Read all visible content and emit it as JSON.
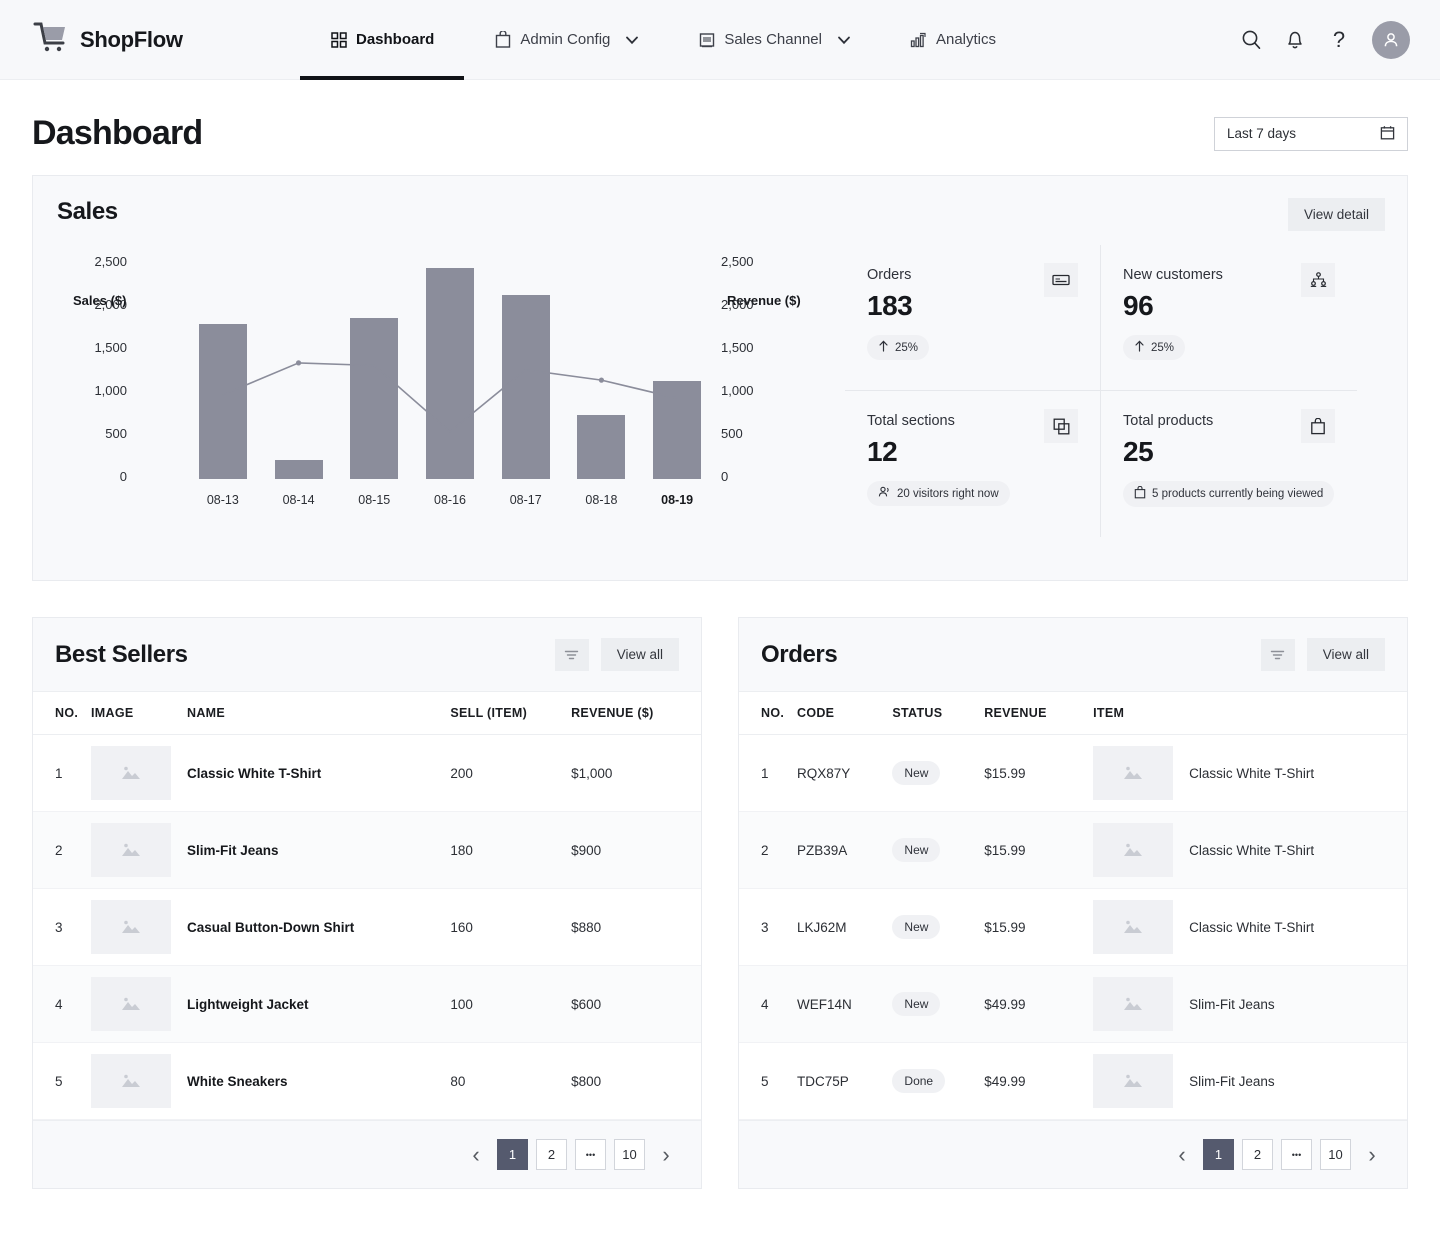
{
  "brand": {
    "name": "ShopFlow",
    "logo_icon": "shopping-cart-icon"
  },
  "nav": {
    "items": [
      {
        "label": "Dashboard",
        "icon": "grid-icon",
        "active": true,
        "caret": false
      },
      {
        "label": "Admin Config",
        "icon": "bag-icon",
        "active": false,
        "caret": true
      },
      {
        "label": "Sales Channel",
        "icon": "store-icon",
        "active": false,
        "caret": true
      },
      {
        "label": "Analytics",
        "icon": "bar-chart-icon",
        "active": false,
        "caret": false
      }
    ],
    "actions": [
      {
        "name": "search-icon"
      },
      {
        "name": "notification-bell-icon"
      },
      {
        "name": "help-icon",
        "glyph": "?"
      },
      {
        "name": "avatar"
      }
    ]
  },
  "page": {
    "title": "Dashboard",
    "date_range": "Last 7 days",
    "calendar_icon": "calendar-icon"
  },
  "sales": {
    "title": "Sales",
    "view_detail_label": "View detail"
  },
  "chart_data": {
    "type": "bar",
    "title": "Sales",
    "categories": [
      "08-13",
      "08-14",
      "08-15",
      "08-16",
      "08-17",
      "08-18",
      "08-19"
    ],
    "highlighted_category": "08-19",
    "left_axis": {
      "label": "Sales ($)",
      "ticks": [
        "2,500",
        "2,000",
        "1,500",
        "1,000",
        "500",
        "0"
      ],
      "ylim": [
        0,
        2500
      ]
    },
    "right_axis": {
      "label": "Revenue ($)",
      "ticks": [
        "2,500",
        "2,000",
        "1,500",
        "1,000",
        "500",
        "0"
      ],
      "ylim": [
        0,
        2500
      ]
    },
    "series": [
      {
        "name": "Sales ($)",
        "type": "bar",
        "color": "#8b8d9b",
        "values": [
          1800,
          220,
          1870,
          2450,
          2140,
          745,
          1140
        ]
      },
      {
        "name": "Revenue ($)",
        "type": "line",
        "color": "#8b8d9b",
        "values": [
          980,
          1350,
          1320,
          550,
          1270,
          1150,
          940
        ],
        "markers": [
          false,
          true,
          false,
          false,
          false,
          true,
          false
        ]
      }
    ],
    "grid": false,
    "legend": "none"
  },
  "stats": [
    {
      "label": "Orders",
      "value": "183",
      "icon": "card-swipe-icon",
      "pill": {
        "icon": "arrow-up-icon",
        "text": "25%"
      }
    },
    {
      "label": "New customers",
      "value": "96",
      "icon": "people-network-icon",
      "pill": {
        "icon": "arrow-up-icon",
        "text": "25%"
      }
    },
    {
      "label": "Total sections",
      "value": "12",
      "icon": "copy-layers-icon",
      "pill": {
        "icon": "users-icon",
        "text": "20 visitors right now"
      }
    },
    {
      "label": "Total products",
      "value": "25",
      "icon": "bag-icon",
      "pill": {
        "icon": "bag-icon",
        "text": "5 products currently being viewed"
      }
    }
  ],
  "best_sellers": {
    "title": "Best Sellers",
    "filter_icon": "filter-icon",
    "view_all_label": "View all",
    "columns": [
      "NO.",
      "IMAGE",
      "NAME",
      "SELL (ITEM)",
      "REVENUE ($)"
    ],
    "rows": [
      {
        "no": "1",
        "image": "image-placeholder-icon",
        "name": "Classic White T-Shirt",
        "sell": "200",
        "revenue": "$1,000"
      },
      {
        "no": "2",
        "image": "image-placeholder-icon",
        "name": "Slim-Fit Jeans",
        "sell": "180",
        "revenue": "$900"
      },
      {
        "no": "3",
        "image": "image-placeholder-icon",
        "name": "Casual Button-Down Shirt",
        "sell": "160",
        "revenue": "$880"
      },
      {
        "no": "4",
        "image": "image-placeholder-icon",
        "name": "Lightweight Jacket",
        "sell": "100",
        "revenue": "$600"
      },
      {
        "no": "5",
        "image": "image-placeholder-icon",
        "name": "White Sneakers",
        "sell": "80",
        "revenue": "$800"
      }
    ],
    "pagination": {
      "prev": "‹",
      "next": "›",
      "pages": [
        "1",
        "2",
        "•••",
        "10"
      ],
      "active": "1"
    }
  },
  "orders": {
    "title": "Orders",
    "filter_icon": "filter-icon",
    "view_all_label": "View all",
    "columns": [
      "NO.",
      "CODE",
      "STATUS",
      "REVENUE",
      "ITEM",
      ""
    ],
    "rows": [
      {
        "no": "1",
        "code": "RQX87Y",
        "status": "New",
        "revenue": "$15.99",
        "image": "image-placeholder-icon",
        "item": "Classic White T-Shirt"
      },
      {
        "no": "2",
        "code": "PZB39A",
        "status": "New",
        "revenue": "$15.99",
        "image": "image-placeholder-icon",
        "item": "Classic White T-Shirt"
      },
      {
        "no": "3",
        "code": "LKJ62M",
        "status": "New",
        "revenue": "$15.99",
        "image": "image-placeholder-icon",
        "item": "Classic White T-Shirt"
      },
      {
        "no": "4",
        "code": "WEF14N",
        "status": "New",
        "revenue": "$49.99",
        "image": "image-placeholder-icon",
        "item": "Slim-Fit Jeans"
      },
      {
        "no": "5",
        "code": "TDC75P",
        "status": "Done",
        "revenue": "$49.99",
        "image": "image-placeholder-icon",
        "item": "Slim-Fit Jeans"
      }
    ],
    "pagination": {
      "prev": "‹",
      "next": "›",
      "pages": [
        "1",
        "2",
        "•••",
        "10"
      ],
      "active": "1"
    }
  },
  "colors": {
    "bar": "#8b8d9b",
    "line": "#8b8d9b",
    "accent_dark": "#555a6e",
    "panel": "#f8f9fb",
    "text": "#16181c"
  }
}
